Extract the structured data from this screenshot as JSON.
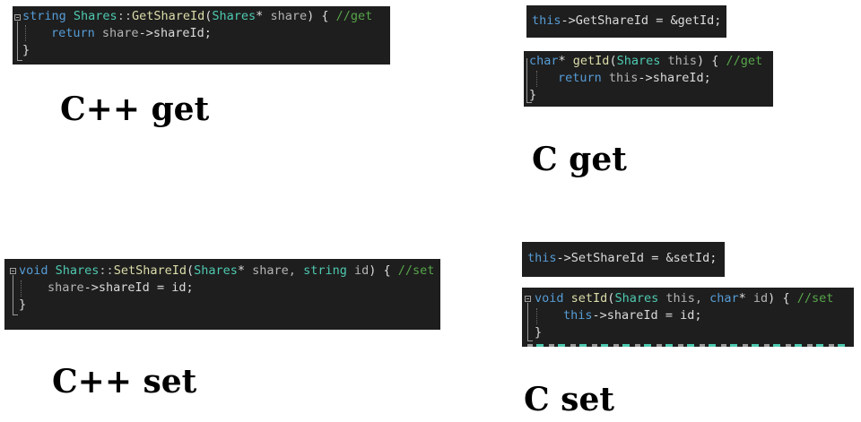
{
  "cpp_get": {
    "line1": {
      "ret": "string",
      "cls": "Shares",
      "sep": "::",
      "fn": "GetShareId",
      "lp": "(",
      "ptype": "Shares",
      "star": "*",
      "pname": " share",
      "rp": ")",
      "brace": " { ",
      "comment": "//get"
    },
    "line2": {
      "ret": "return",
      "obj": " share",
      "arrow": "->",
      "member": "shareId",
      "semi": ";"
    },
    "line3": {
      "close": "}"
    }
  },
  "c_get_assign": {
    "this": "this",
    "arrow": "->",
    "member": "GetShareId",
    "rest": " = &getId;"
  },
  "c_get": {
    "line1": {
      "ret": "char",
      "star": "*",
      "fn": " getId",
      "lp": "(",
      "ptype": "Shares",
      "pname": " this",
      "rp": ")",
      "brace": " { ",
      "comment": "//get"
    },
    "line2": {
      "ret": "return",
      "obj": " this",
      "arrow": "->",
      "member": "shareId",
      "semi": ";"
    },
    "line3": {
      "close": "}"
    }
  },
  "cpp_set": {
    "line1": {
      "ret": "void",
      "cls": " Shares",
      "sep": "::",
      "fn": "SetShareId",
      "lp": "(",
      "ptype": "Shares",
      "star": "*",
      "pname": " share, ",
      "ptype2": "string",
      "pname2": " id",
      "rp": ")",
      "brace": " { ",
      "comment": "//set"
    },
    "line2": {
      "obj": "share",
      "arrow": "->",
      "member": "shareId",
      "rest": " = id;"
    },
    "line3": {
      "close": "}"
    }
  },
  "c_set_assign": {
    "this": "this",
    "arrow": "->",
    "member": "SetShareId",
    "rest": " = &setId;"
  },
  "c_set": {
    "line1": {
      "ret": "void",
      "fn": " setId",
      "lp": "(",
      "ptype": "Shares",
      "pname": " this, ",
      "ptype2": "char",
      "star": "*",
      "pname2": " id",
      "rp": ")",
      "brace": " { ",
      "comment": "//set"
    },
    "line2": {
      "obj": "this",
      "arrow": "->",
      "member": "shareId",
      "rest": " = id;"
    },
    "line3": {
      "close": "}"
    }
  },
  "captions": {
    "cpp_get": "C++ get",
    "c_get": "C get",
    "cpp_set": "C++ set",
    "c_set": "C set"
  },
  "colors": {
    "editor_bg": "#1e1e1e",
    "keyword": "#569cd6",
    "type": "#4ec9b0",
    "function": "#dcdcaa",
    "comment": "#57a64a",
    "text": "#dcdcdc"
  }
}
